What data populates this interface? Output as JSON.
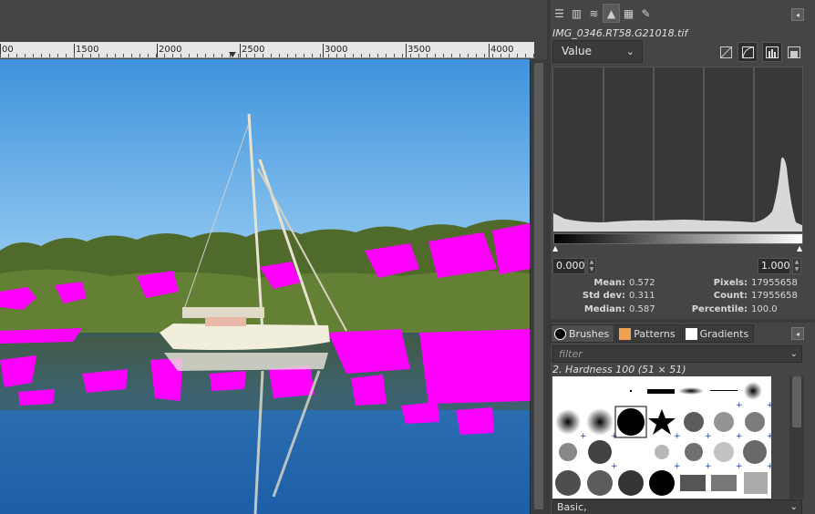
{
  "ruler": {
    "labels": [
      "00",
      "1500",
      "2000",
      "2500",
      "3000",
      "3500",
      "4000"
    ]
  },
  "histogram": {
    "title": "IMG_0346.RT58.G21018.tif",
    "channel": "Value",
    "range_min": "0.000",
    "range_max": "1.000",
    "stats": {
      "mean_label": "Mean:",
      "mean": "0.572",
      "stddev_label": "Std dev:",
      "stddev": "0.311",
      "median_label": "Median:",
      "median": "0.587",
      "pixels_label": "Pixels:",
      "pixels": "17955658",
      "count_label": "Count:",
      "count": "17955658",
      "percentile_label": "Percentile:",
      "percentile": "100.0"
    }
  },
  "brushes": {
    "tabs": [
      {
        "label": "Brushes",
        "icon": "brush-circle-icon",
        "color": "#000000"
      },
      {
        "label": "Patterns",
        "icon": "pattern-swatch-icon",
        "color": "#f0a050"
      },
      {
        "label": "Gradients",
        "icon": "gradient-swatch-icon",
        "color": "#ffffff"
      }
    ],
    "filter_placeholder": "filter",
    "selected_brush": "2. Hardness 100 (51 × 51)",
    "brush_set": "Basic,"
  },
  "colors": {
    "overlay_magenta": "#ff00ff",
    "sky": "#4a9ee0",
    "panel_bg": "#454545"
  }
}
